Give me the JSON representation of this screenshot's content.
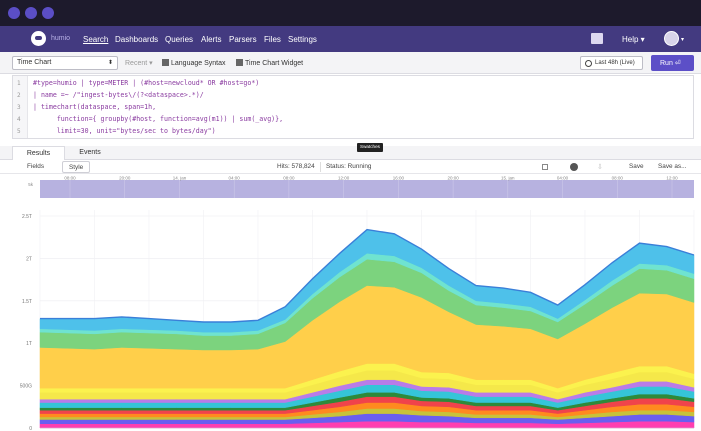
{
  "window": {
    "dots": [
      "#5b4ec6",
      "#5b4ec6",
      "#5b4ec6"
    ]
  },
  "nav": {
    "brand": "humio",
    "items": [
      {
        "label": "Search",
        "active": true
      },
      {
        "label": "Dashboards"
      },
      {
        "label": "Queries"
      },
      {
        "label": "Alerts"
      },
      {
        "label": "Parsers"
      },
      {
        "label": "Files"
      },
      {
        "label": "Settings"
      }
    ],
    "help_label": "Help ▾"
  },
  "toolbar": {
    "widget_select": "Time Chart",
    "recent_label": "Recent ▾",
    "language_syntax": "Language Syntax",
    "time_chart_widget": "Time Chart Widget",
    "time_range": "Last 48h (Live)",
    "run_label": "Run ⏎"
  },
  "editor": {
    "line_numbers": [
      "1",
      "2",
      "3",
      "4",
      "5"
    ],
    "lines": [
      "#type=humio | type=METER | (#host=newcloud* OR #host=go*)",
      "| name =~ /\"ingest-bytes\\/(?<dataspace>.*)/",
      "| timechart(dataspace, span=1h,",
      "      function={ groupby(#host, function=avg(m1)) | sum(_avg)},",
      "      limit=30, unit=\"bytes/sec to bytes/day\")"
    ]
  },
  "tooltip": "Swatches",
  "tabs": {
    "results": "Results",
    "events": "Events"
  },
  "resbar": {
    "fields": "Fields",
    "style": "Style",
    "hits": "Hits: 578,824",
    "status": "Status: Running",
    "save": "Save",
    "save_as": "Save as..."
  },
  "accent": "#5c4fc7",
  "chart_data": {
    "type": "area",
    "stacked": true,
    "overview": {
      "y_label": "5k",
      "time_ticks": [
        "08:00",
        "20:00",
        "14. jan",
        "04:00",
        "08:00",
        "12:00",
        "16:00",
        "20:00",
        "15. jan",
        "04:00",
        "08:00",
        "12:00"
      ]
    },
    "y_ticks": [
      "0",
      "500G",
      "1T",
      "1.5T",
      "2T",
      "2.5T"
    ],
    "ylim": [
      0,
      2.5
    ],
    "grid": true,
    "x": [
      0,
      2,
      4,
      6,
      8,
      10,
      12,
      14,
      16,
      18,
      20,
      22,
      24,
      26,
      28,
      30,
      32,
      34,
      36,
      38,
      40,
      42,
      44,
      46,
      48
    ],
    "series": [
      {
        "color": "#ff3eb0",
        "values": [
          0.05,
          0.05,
          0.05,
          0.05,
          0.05,
          0.05,
          0.05,
          0.05,
          0.05,
          0.05,
          0.06,
          0.07,
          0.08,
          0.08,
          0.07,
          0.07,
          0.06,
          0.06,
          0.06,
          0.05,
          0.06,
          0.07,
          0.08,
          0.08,
          0.07
        ]
      },
      {
        "color": "#6a5ef0",
        "values": [
          0.05,
          0.05,
          0.05,
          0.05,
          0.05,
          0.05,
          0.05,
          0.05,
          0.05,
          0.05,
          0.06,
          0.07,
          0.09,
          0.09,
          0.08,
          0.07,
          0.06,
          0.06,
          0.06,
          0.05,
          0.06,
          0.07,
          0.08,
          0.08,
          0.07
        ]
      },
      {
        "color": "#c8c23a",
        "values": [
          0.03,
          0.03,
          0.03,
          0.03,
          0.03,
          0.03,
          0.03,
          0.03,
          0.03,
          0.03,
          0.04,
          0.05,
          0.06,
          0.06,
          0.05,
          0.05,
          0.04,
          0.04,
          0.04,
          0.03,
          0.04,
          0.05,
          0.05,
          0.05,
          0.05
        ]
      },
      {
        "color": "#ff8a1f",
        "values": [
          0.04,
          0.04,
          0.04,
          0.04,
          0.04,
          0.04,
          0.04,
          0.04,
          0.04,
          0.04,
          0.05,
          0.06,
          0.07,
          0.07,
          0.06,
          0.06,
          0.05,
          0.05,
          0.05,
          0.04,
          0.05,
          0.06,
          0.07,
          0.07,
          0.06
        ]
      },
      {
        "color": "#f0434b",
        "values": [
          0.04,
          0.04,
          0.04,
          0.04,
          0.04,
          0.04,
          0.04,
          0.04,
          0.04,
          0.04,
          0.05,
          0.06,
          0.07,
          0.07,
          0.06,
          0.06,
          0.05,
          0.05,
          0.05,
          0.04,
          0.05,
          0.06,
          0.07,
          0.07,
          0.06
        ]
      },
      {
        "color": "#2e8a3a",
        "values": [
          0.03,
          0.03,
          0.03,
          0.03,
          0.03,
          0.03,
          0.03,
          0.03,
          0.03,
          0.03,
          0.04,
          0.05,
          0.05,
          0.05,
          0.04,
          0.04,
          0.04,
          0.04,
          0.04,
          0.03,
          0.04,
          0.04,
          0.05,
          0.05,
          0.04
        ]
      },
      {
        "color": "#35c5d8",
        "values": [
          0.06,
          0.06,
          0.06,
          0.06,
          0.06,
          0.06,
          0.06,
          0.06,
          0.06,
          0.06,
          0.07,
          0.08,
          0.09,
          0.09,
          0.08,
          0.08,
          0.07,
          0.07,
          0.07,
          0.06,
          0.07,
          0.08,
          0.09,
          0.09,
          0.08
        ]
      },
      {
        "color": "#b97ce8",
        "values": [
          0.04,
          0.04,
          0.04,
          0.04,
          0.04,
          0.04,
          0.04,
          0.04,
          0.04,
          0.04,
          0.05,
          0.06,
          0.06,
          0.06,
          0.05,
          0.05,
          0.05,
          0.05,
          0.05,
          0.04,
          0.05,
          0.05,
          0.06,
          0.06,
          0.05
        ]
      },
      {
        "color": "#f5e84a",
        "values": [
          0.08,
          0.08,
          0.08,
          0.08,
          0.08,
          0.08,
          0.08,
          0.08,
          0.08,
          0.08,
          0.09,
          0.1,
          0.11,
          0.11,
          0.1,
          0.1,
          0.09,
          0.09,
          0.09,
          0.08,
          0.09,
          0.1,
          0.11,
          0.11,
          0.1
        ]
      },
      {
        "color": "#fbf24e",
        "values": [
          0.05,
          0.05,
          0.05,
          0.05,
          0.05,
          0.05,
          0.05,
          0.05,
          0.05,
          0.05,
          0.06,
          0.07,
          0.08,
          0.08,
          0.07,
          0.07,
          0.06,
          0.06,
          0.06,
          0.05,
          0.06,
          0.07,
          0.07,
          0.07,
          0.06
        ]
      },
      {
        "color": "#ffcf4a",
        "values": [
          0.48,
          0.47,
          0.46,
          0.48,
          0.47,
          0.46,
          0.45,
          0.45,
          0.46,
          0.55,
          0.7,
          0.82,
          0.92,
          0.9,
          0.88,
          0.72,
          0.65,
          0.63,
          0.6,
          0.58,
          0.66,
          0.77,
          0.86,
          0.85,
          0.84
        ]
      },
      {
        "color": "#7cd37e",
        "values": [
          0.18,
          0.18,
          0.18,
          0.18,
          0.18,
          0.18,
          0.17,
          0.17,
          0.18,
          0.22,
          0.26,
          0.29,
          0.31,
          0.3,
          0.29,
          0.25,
          0.23,
          0.22,
          0.21,
          0.2,
          0.23,
          0.26,
          0.29,
          0.28,
          0.28
        ]
      },
      {
        "color": "#6fe3d0",
        "values": [
          0.04,
          0.04,
          0.04,
          0.04,
          0.04,
          0.04,
          0.04,
          0.04,
          0.04,
          0.04,
          0.05,
          0.06,
          0.07,
          0.07,
          0.06,
          0.06,
          0.05,
          0.05,
          0.05,
          0.04,
          0.05,
          0.06,
          0.06,
          0.06,
          0.06
        ]
      },
      {
        "color": "#4ec1ea",
        "values": [
          0.12,
          0.13,
          0.14,
          0.14,
          0.13,
          0.12,
          0.12,
          0.12,
          0.12,
          0.15,
          0.18,
          0.22,
          0.28,
          0.26,
          0.22,
          0.2,
          0.18,
          0.18,
          0.17,
          0.16,
          0.18,
          0.21,
          0.24,
          0.22,
          0.22
        ]
      }
    ]
  }
}
